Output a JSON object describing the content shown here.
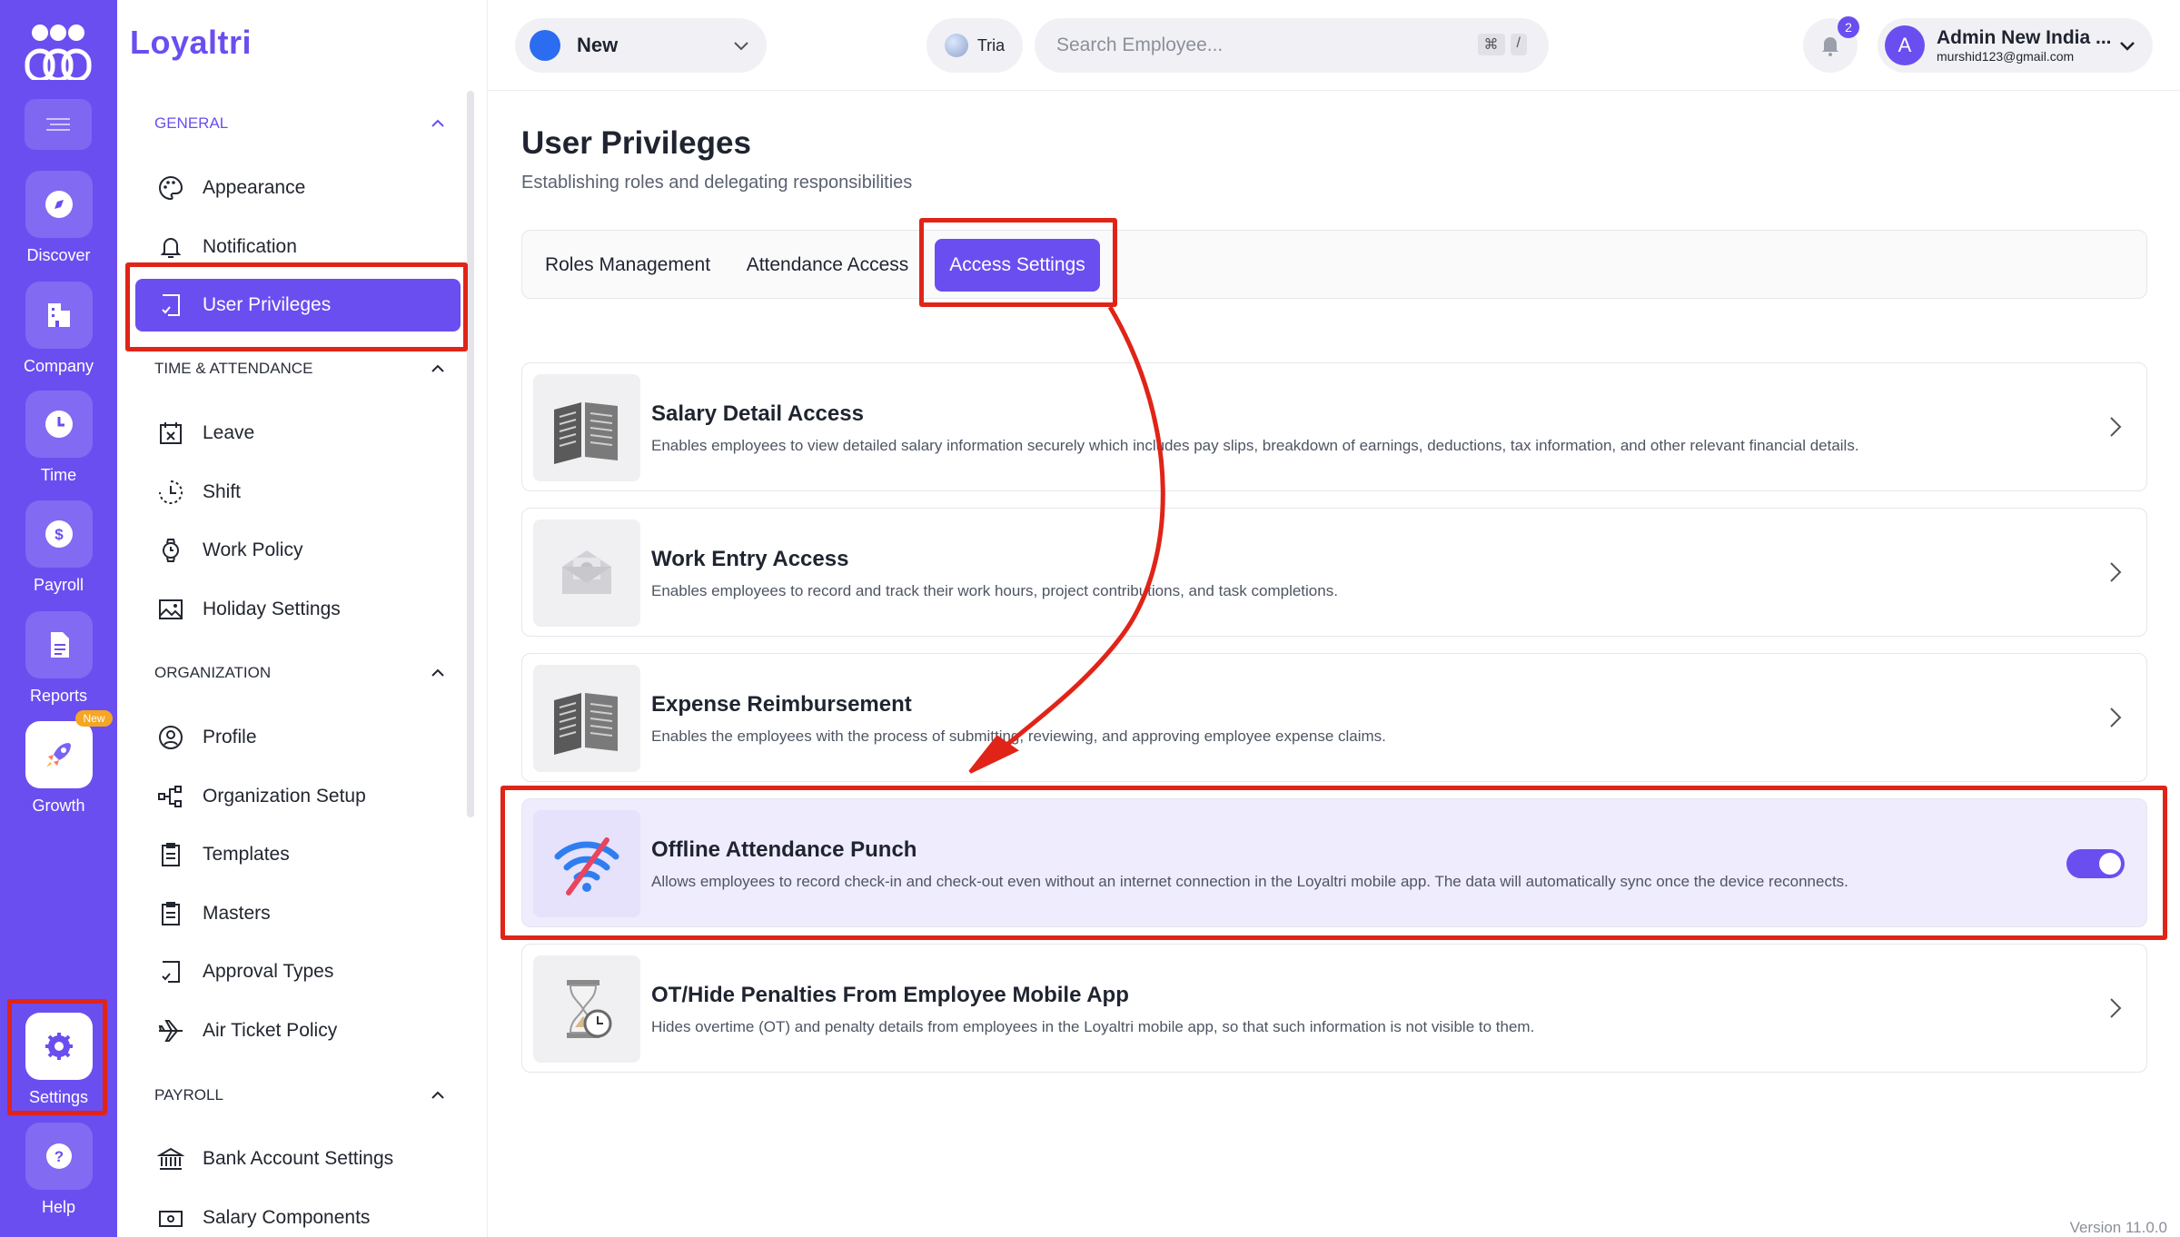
{
  "rail": {
    "items": [
      {
        "label": "Discover",
        "icon": "compass-icon"
      },
      {
        "label": "Company",
        "icon": "building-icon"
      },
      {
        "label": "Time",
        "icon": "clock-icon"
      },
      {
        "label": "Payroll",
        "icon": "dollar-icon"
      },
      {
        "label": "Reports",
        "icon": "document-icon"
      },
      {
        "label": "Growth",
        "icon": "rocket-icon",
        "badge": "New"
      },
      {
        "label": "Settings",
        "icon": "gear-icon"
      },
      {
        "label": "Help",
        "icon": "help-icon"
      }
    ]
  },
  "sidebar": {
    "brand": "Loyaltri",
    "sections": {
      "general": "GENERAL",
      "time": "TIME & ATTENDANCE",
      "organization": "ORGANIZATION",
      "payroll": "PAYROLL"
    },
    "items": {
      "appearance": "Appearance",
      "notification": "Notification",
      "user_privileges": "User Privileges",
      "leave": "Leave",
      "shift": "Shift",
      "work_policy": "Work Policy",
      "holiday": "Holiday Settings",
      "profile": "Profile",
      "org_setup": "Organization Setup",
      "templates": "Templates",
      "masters": "Masters",
      "approval": "Approval Types",
      "air_ticket": "Air Ticket Policy",
      "bank": "Bank Account Settings",
      "salary_components": "Salary Components"
    }
  },
  "topbar": {
    "branch": "New",
    "assistant": "Tria",
    "search_placeholder": "Search Employee...",
    "kbd_cmd": "⌘",
    "kbd_slash": "/",
    "notifications": "2",
    "avatar_initial": "A",
    "user_name": "Admin New India ...",
    "user_email": "murshid123@gmail.com"
  },
  "main": {
    "title": "User Privileges",
    "subtitle": "Establishing roles and delegating responsibilities",
    "tabs": [
      "Roles Management",
      "Attendance Access",
      "Access Settings"
    ],
    "active_tab": "Access Settings",
    "cards": [
      {
        "title": "Salary Detail Access",
        "desc": "Enables employees to view detailed salary information securely which includes pay slips, breakdown of earnings, deductions, tax information, and other relevant financial details."
      },
      {
        "title": "Work Entry Access",
        "desc": "Enables employees to record and track their work hours, project contributions, and task completions."
      },
      {
        "title": "Expense Reimbursement",
        "desc": "Enables the employees with the process of submitting, reviewing, and approving employee expense claims."
      },
      {
        "title": "Offline Attendance Punch",
        "desc": "Allows employees to record check-in and check-out even without an internet connection in the Loyaltri mobile app. The data will automatically sync once the device reconnects.",
        "enabled": true
      },
      {
        "title": "OT/Hide Penalties From Employee Mobile App",
        "desc": "Hides overtime (OT) and penalty details from employees in the Loyaltri mobile app, so that such information is not visible to them."
      }
    ]
  },
  "version": "Version 11.0.0",
  "colors": {
    "accent": "#6b4ef0",
    "annotation": "#e02418"
  }
}
